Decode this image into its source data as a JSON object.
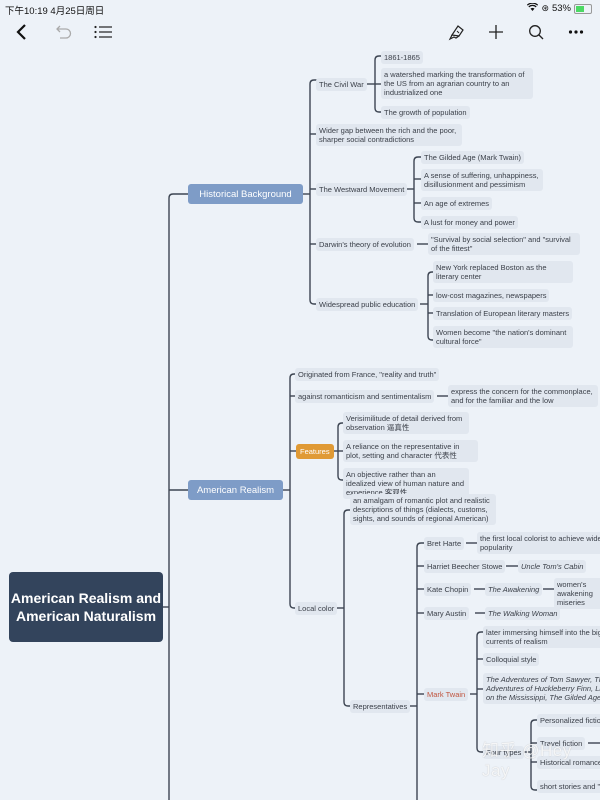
{
  "status_bar": {
    "time": "下午10:19  4月25日周日",
    "battery": "53%"
  },
  "toolbar": {
    "back": "back-icon",
    "undo": "undo-icon",
    "outline": "list-icon",
    "style": "paint-bucket-icon",
    "add": "plus-icon",
    "search": "search-icon",
    "more": "more-icon"
  },
  "mindmap": {
    "root": "American Realism and American Naturalism",
    "historical": {
      "label": "Historical Background",
      "civil_war": {
        "label": "The Civil War",
        "children": [
          "1861-1865",
          "a watershed marking the transformation of the US from an agrarian country to an industrialized one",
          "The growth of population"
        ]
      },
      "gap": "Wider gap between the rich and the poor, sharper social contradictions",
      "westward": {
        "label": "The Westward Movement",
        "children": [
          "The Gilded Age (Mark Twain)",
          "A sense of suffering, unhappiness, disillusionment and pessimism",
          "An age of extremes",
          "A lust for money and power"
        ]
      },
      "darwin": {
        "label": "Darwin's theory of evolution",
        "child": "\"Survival by social selection\" and \"survival of the fittest\""
      },
      "education": {
        "label": "Widespread public education",
        "children": [
          "New York replaced Boston as the literary center",
          "low-cost magazines, newspapers",
          "Translation of European literary masters",
          "Women become \"the nation's dominant cultural force\""
        ]
      }
    },
    "realism": {
      "label": "American Realism",
      "origin": "Originated from France, \"reality and truth\"",
      "against": {
        "label": "against romanticism and sentimentalism",
        "child": "express the concern for the commonplace, and for the familiar and the low"
      },
      "features": {
        "label": "Features",
        "children": [
          "Verisimilitude of detail derived from observation 逼真性",
          "A reliance on the representative in plot, setting and character 代表性",
          "An objective rather than an idealized view of human nature and experience 客观性"
        ]
      },
      "local_color": {
        "label": "Local color",
        "amalgam": "an amalgam of romantic plot and realistic descriptions of things (dialects, customs, sights, and sounds of regional American)",
        "representatives": {
          "label": "Representatives",
          "bret_harte": {
            "label": "Bret Harte",
            "child": "the first local colorist to achieve wide popularity"
          },
          "stowe": {
            "label": "Harriet Beecher Stowe",
            "child": "Uncle Tom's Cabin"
          },
          "chopin": {
            "label": "Kate Chopin",
            "work": "The Awakening",
            "note": "women's awakening miseries"
          },
          "austin": {
            "label": "Mary Austin",
            "work": "The Walking Woman"
          },
          "twain": {
            "label": "Mark Twain",
            "children": [
              "later immersing himself into the big currents of realism",
              "Colloquial style",
              "The Adventures of Tom Sawyer, The Adventures of Huckleberry Finn, Life on the Mississippi, The Gilded Age"
            ],
            "four_types": {
              "label": "Four types",
              "children": [
                "Personalized fiction",
                "Travel fiction",
                "Historical romance",
                "short stories and \""
              ]
            }
          }
        }
      }
    }
  },
  "watermark": "知乎 @Hey Jay"
}
